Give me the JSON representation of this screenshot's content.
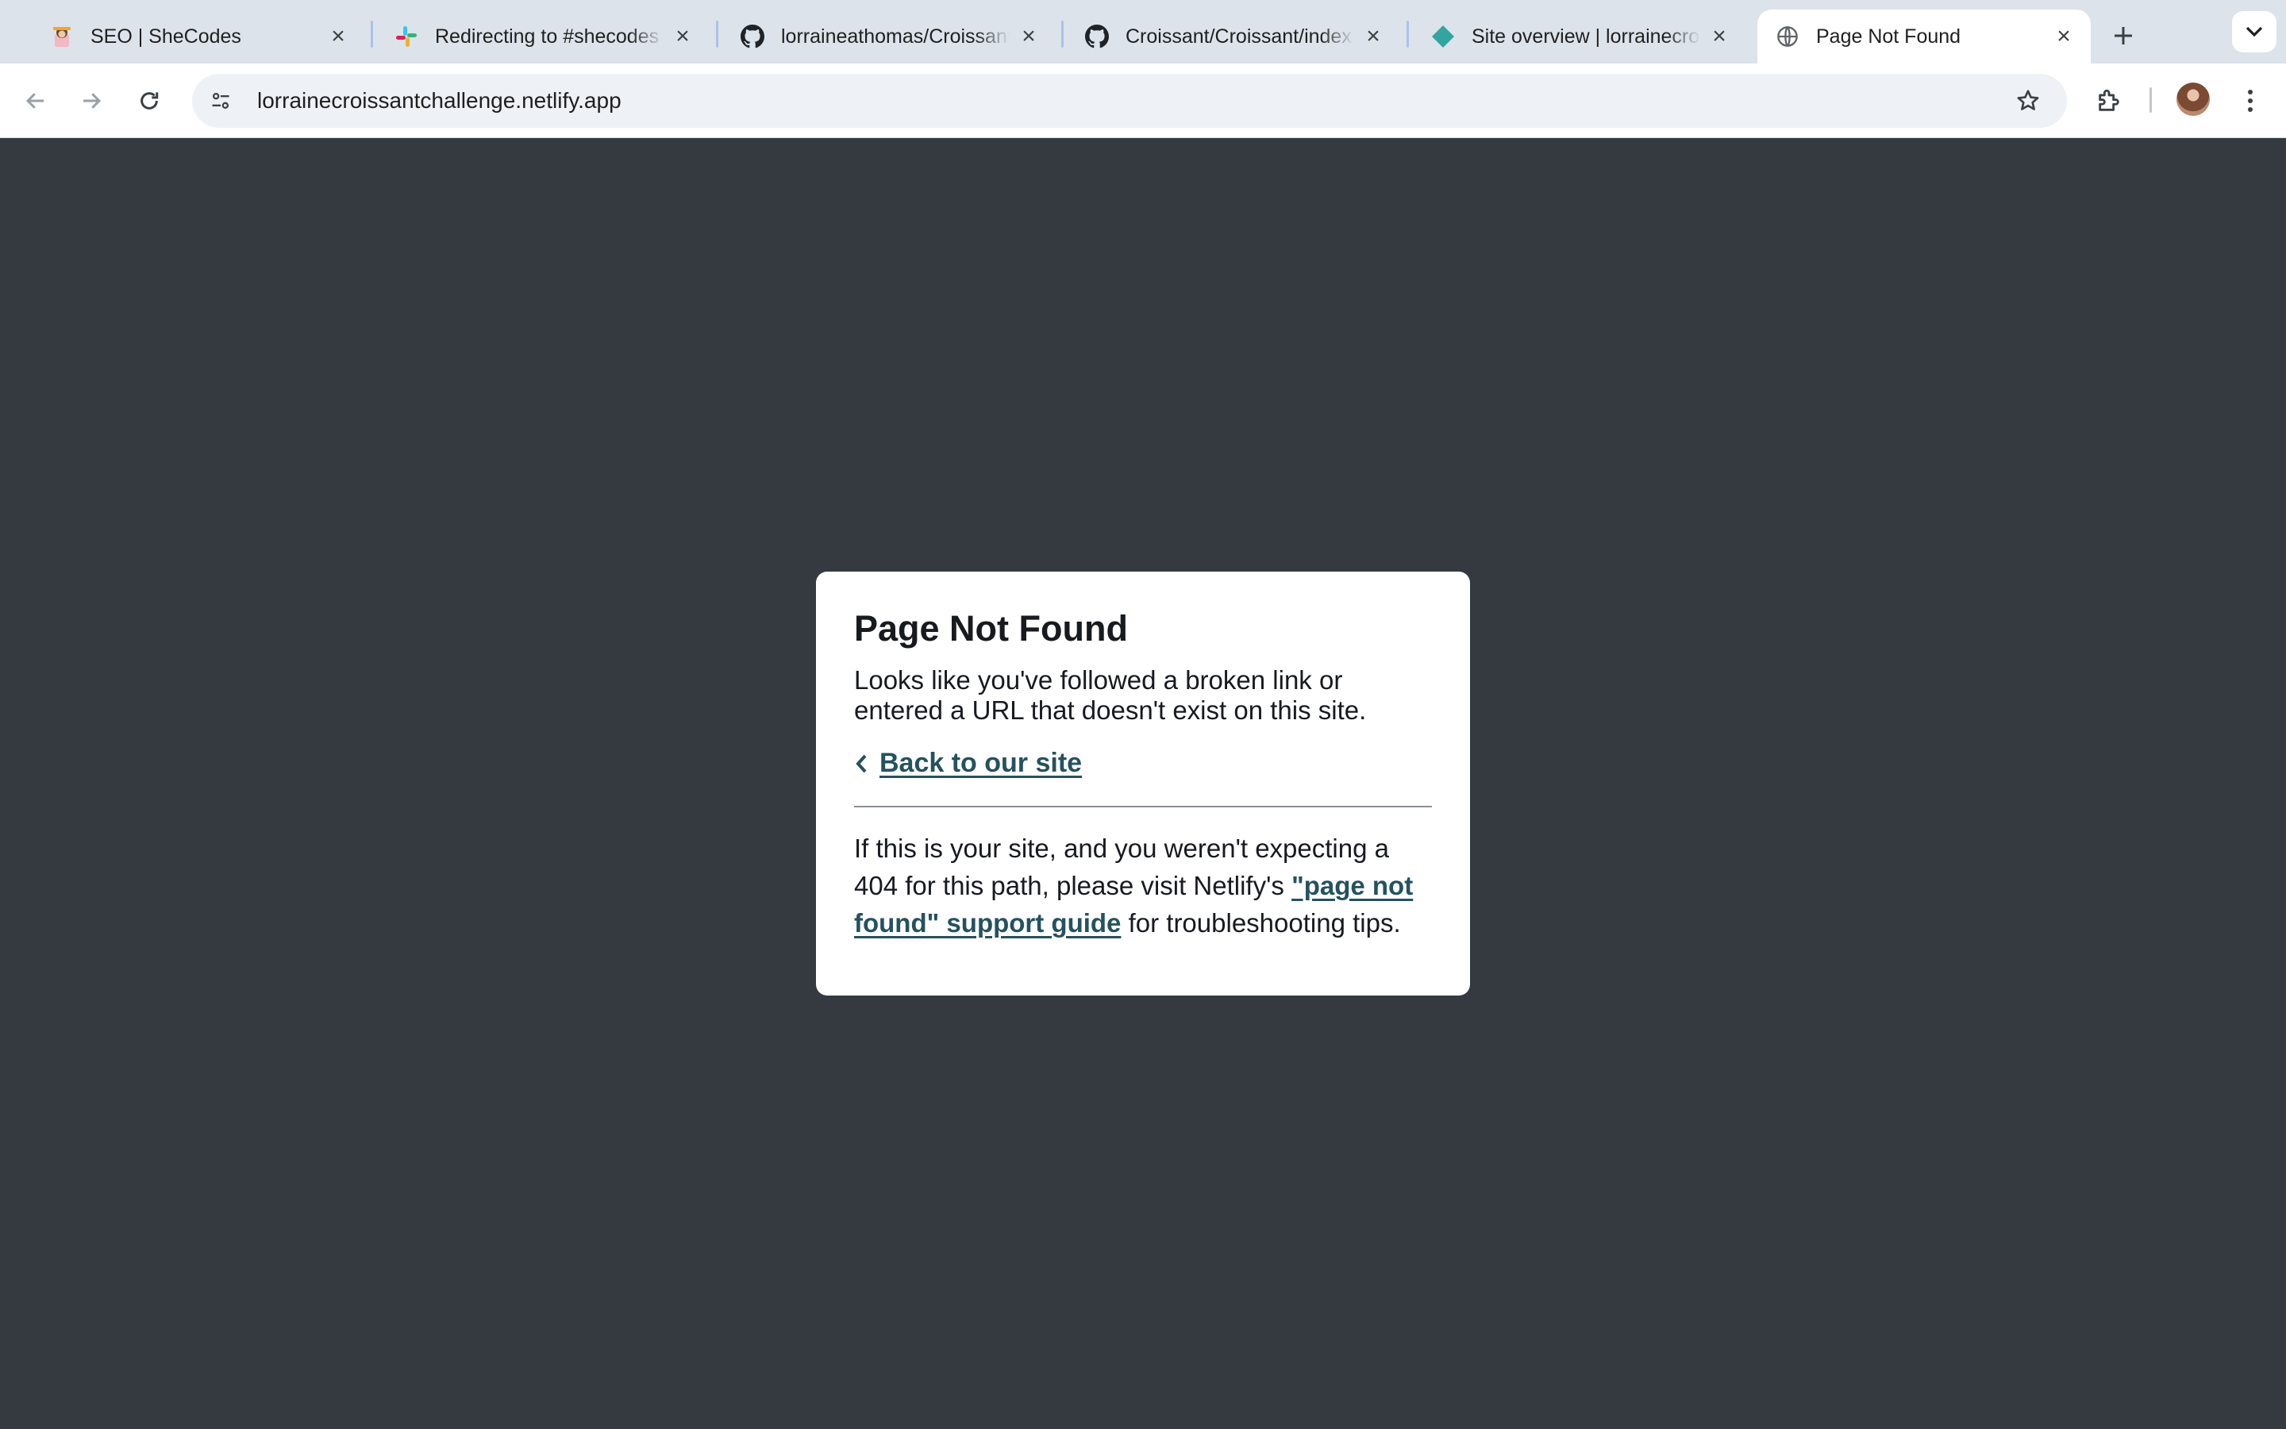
{
  "browser": {
    "tabs": [
      {
        "title": "SEO | SheCodes",
        "favicon": "shecodes-icon",
        "active": false
      },
      {
        "title": "Redirecting to #shecodes",
        "favicon": "slack-icon",
        "active": false
      },
      {
        "title": "lorraineathomas/Croissant",
        "favicon": "github-icon",
        "active": false
      },
      {
        "title": "Croissant/Croissant/index",
        "favicon": "github-icon",
        "active": false
      },
      {
        "title": "Site overview | lorrainecroissant",
        "favicon": "netlify-icon",
        "active": false
      },
      {
        "title": "Page Not Found",
        "favicon": "globe-icon",
        "active": true
      }
    ],
    "address_bar": {
      "url": "lorrainecroissantchallenge.netlify.app"
    },
    "colors": {
      "tabstrip_bg": "#dde3ea",
      "active_tab_bg": "#ffffff",
      "omnibox_bg": "#eef1f5"
    }
  },
  "page": {
    "background": "#343a40",
    "heading": "Page Not Found",
    "description": "Looks like you've followed a broken link or entered a URL that doesn't exist on this site.",
    "back_link": "Back to our site",
    "help_before": "If this is your site, and you weren't expecting a 404 for this path, please visit Netlify's ",
    "help_link": "\"page not found\" support guide",
    "help_after": " for troubleshooting tips.",
    "link_color": "#24525e"
  }
}
